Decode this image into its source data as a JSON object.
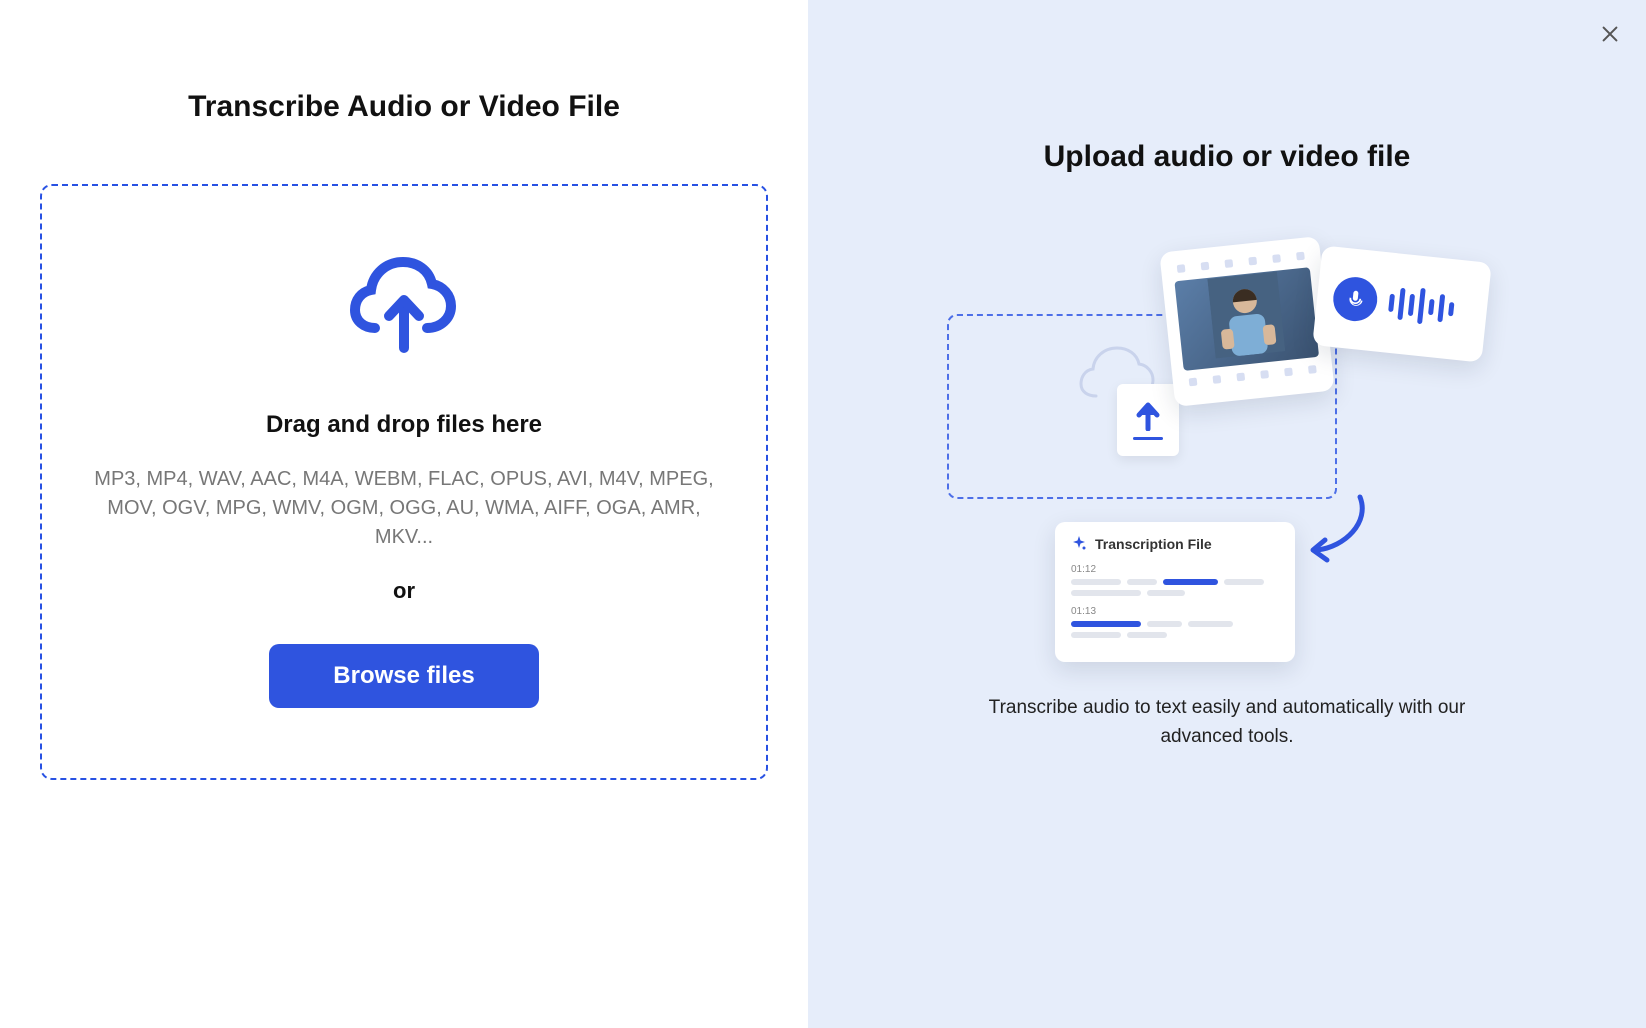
{
  "left": {
    "title": "Transcribe Audio or Video File",
    "drop_heading": "Drag and drop files here",
    "formats": "MP3, MP4, WAV, AAC, M4A, WEBM, FLAC, OPUS, AVI, M4V, MPEG, MOV, OGV, MPG, WMV, OGM, OGG, AU, WMA, AIFF, OGA, AMR, MKV...",
    "or": "or",
    "browse_label": "Browse files"
  },
  "right": {
    "title": "Upload audio or video file",
    "description": "Transcribe audio to text easily and automatically with our advanced tools.",
    "transcription_card": {
      "title": "Transcription File",
      "row1_time": "01:12",
      "row2_time": "01:13"
    }
  }
}
